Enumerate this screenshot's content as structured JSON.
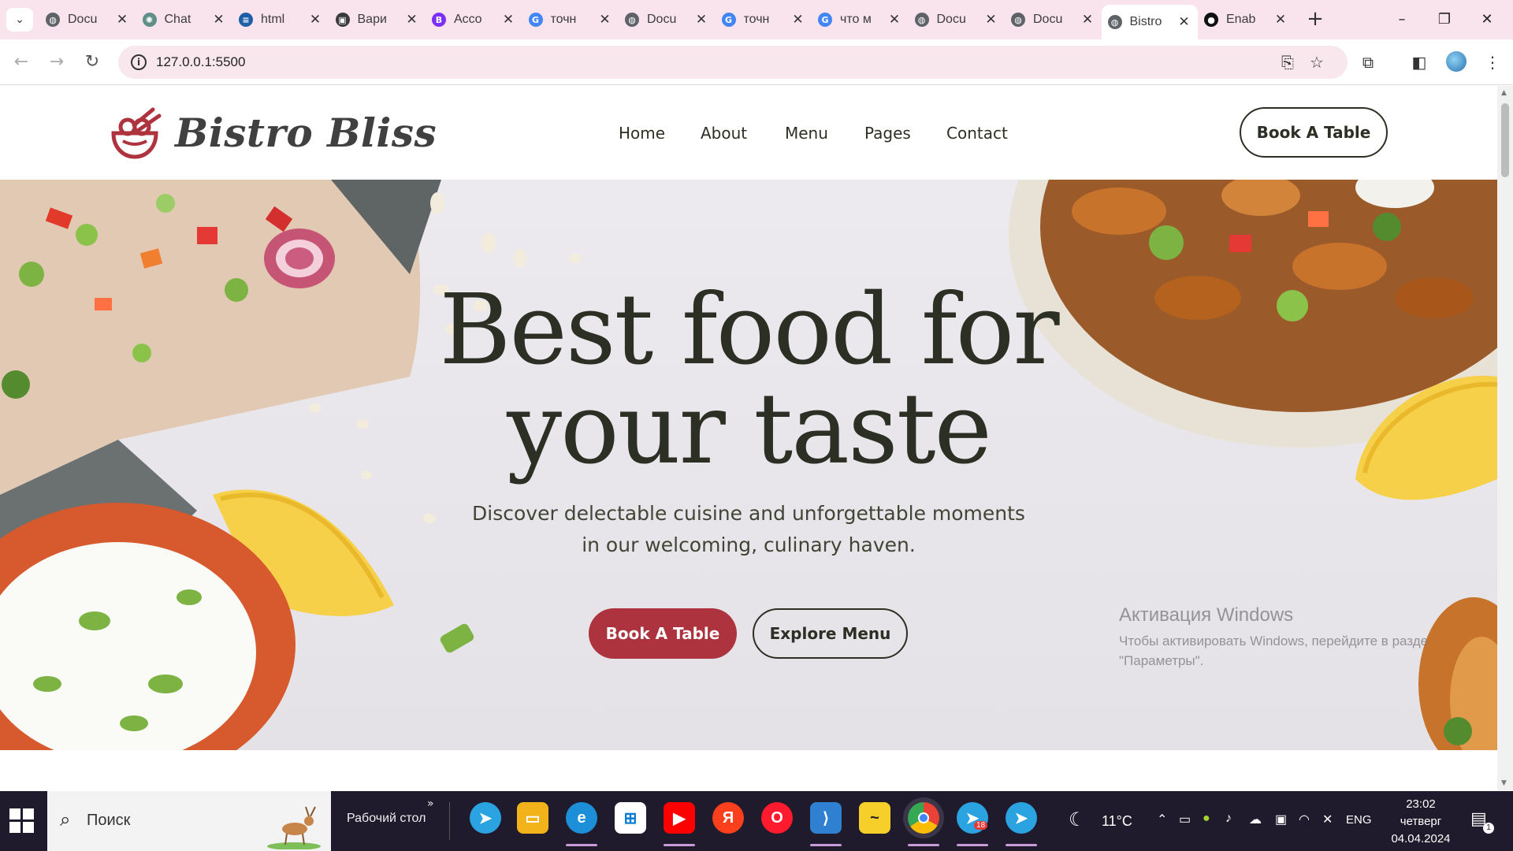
{
  "browser": {
    "tabs": [
      {
        "label": "Docu",
        "favicon": "globe-icon",
        "color": "#5f6368"
      },
      {
        "label": "Chat",
        "favicon": "chatgpt-icon",
        "color": "#5f8f86"
      },
      {
        "label": "html",
        "favicon": "docs-icon",
        "color": "#1f5fa8"
      },
      {
        "label": "Вари",
        "favicon": "media-icon",
        "color": "#3a3a3a"
      },
      {
        "label": "Acco",
        "favicon": "b-icon",
        "color": "#7b2ff7"
      },
      {
        "label": "точн",
        "favicon": "google-icon",
        "color": "#4285f4"
      },
      {
        "label": "Docu",
        "favicon": "globe-icon",
        "color": "#5f6368"
      },
      {
        "label": "точн",
        "favicon": "google-icon",
        "color": "#4285f4"
      },
      {
        "label": "что м",
        "favicon": "google-icon",
        "color": "#4285f4"
      },
      {
        "label": "Docu",
        "favicon": "globe-icon",
        "color": "#5f6368"
      },
      {
        "label": "Docu",
        "favicon": "globe-icon",
        "color": "#5f6368"
      },
      {
        "label": "Bistro",
        "favicon": "globe-icon",
        "color": "#5f6368",
        "active": true
      },
      {
        "label": "Enab",
        "favicon": "github-icon",
        "color": "#111111"
      }
    ],
    "url": "127.0.0.1:5500"
  },
  "site": {
    "brand": "Bistro Bliss",
    "nav": [
      "Home",
      "About",
      "Menu",
      "Pages",
      "Contact"
    ],
    "header_cta": "Book A Table",
    "hero": {
      "title_line1": "Best food for",
      "title_line2": "your taste",
      "subtitle_line1": "Discover delectable cuisine and unforgettable moments",
      "subtitle_line2": "in our welcoming, culinary haven.",
      "primary_cta": "Book A Table",
      "secondary_cta": "Explore Menu"
    },
    "colors": {
      "accent": "#ad343e",
      "text": "#2c2f24"
    }
  },
  "watermark": {
    "line1": "Активация Windows",
    "line2": "Чтобы активировать Windows, перейдите в разде",
    "line3": "\"Параметры\"."
  },
  "taskbar": {
    "search_placeholder": "Поиск",
    "desktop_label": "Рабочий стол",
    "apps": [
      "telegram",
      "explorer",
      "edge",
      "store",
      "youtube",
      "yandex",
      "opera",
      "vscode",
      "yandex-games",
      "chrome",
      "telegram-alt",
      "telegram-beta"
    ],
    "telegram_badge": "18",
    "weather": "11°C",
    "language": "ENG",
    "time": "23:02",
    "day": "четверг",
    "date": "04.04.2024",
    "notifications": "1"
  }
}
